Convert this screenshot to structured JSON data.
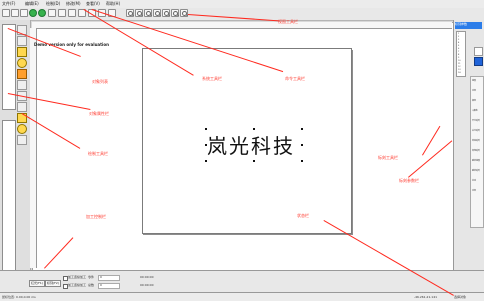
{
  "menu": {
    "items": [
      "文件(F)",
      "编辑(E)",
      "绘制(D)",
      "修改(M)",
      "查看(V)",
      "帮助(H)"
    ]
  },
  "workspace": {
    "trial_text": "Demo version only for evaluation",
    "canvas_text": "岚光科技"
  },
  "annotations": [
    "对象列表",
    "对象属性栏",
    "绘制工具栏",
    "加工控制栏",
    "系统工具栏",
    "命令工具栏",
    "视图工具栏",
    "状态栏",
    "标刻参数栏",
    "标刻工具栏"
  ],
  "bottom_controls": {
    "left_buttons": [
      "红光(F1)",
      "标刻(F2)"
    ],
    "check1": "加工连续加工",
    "check2": "加工连续加工",
    "field_labels": [
      "零件",
      "总数"
    ],
    "field_values": [
      "0",
      "0"
    ],
    "time_label": "00:00:00",
    "time_label2": "00:00:00"
  },
  "status": {
    "left": "鼠标位置: 0.00,0.00 ms",
    "right": "-46.261,21.141",
    "mode": "选择对象"
  },
  "right_panel": {
    "title": "标刻参数",
    "list": [
      "1",
      "2",
      "3",
      "4",
      "5",
      "6",
      "7",
      "8",
      "9",
      "10",
      "11",
      "12",
      "13",
      "14"
    ],
    "params": [
      "速度",
      "功率",
      "频率",
      "Q释放",
      "开光延时",
      "关光延时",
      "结束延时",
      "拐角延时",
      "跳转速度",
      "跳转延时",
      "抖动",
      "功率"
    ]
  },
  "accent_colors": {
    "annotation": "#ff3b30",
    "panel_blue": "#2b7de9",
    "highlight_blue": "#1f63d9"
  }
}
